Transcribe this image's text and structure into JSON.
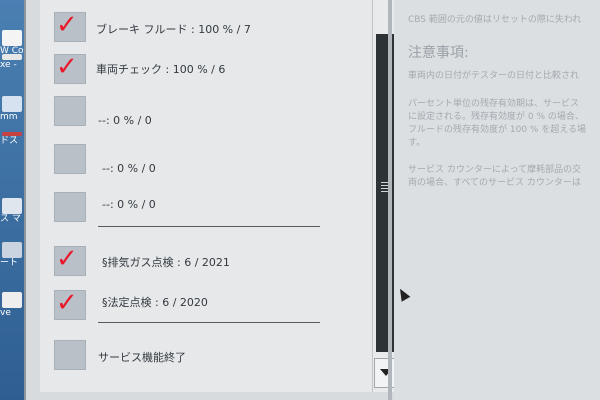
{
  "desktop": {
    "icons": [
      {
        "label": "W Co",
        "color": "#f4f4f4"
      },
      {
        "label": "xe -",
        "color": "#e7e7e7"
      },
      {
        "label": "mm",
        "color": "#d6e2ef"
      },
      {
        "label": "ドス",
        "color": "#c84040"
      },
      {
        "label": "ス マ",
        "color": "#dfe6ee"
      },
      {
        "label": "ート",
        "color": "#c9d4e0"
      },
      {
        "label": "ve",
        "color": "#eeeeee"
      }
    ]
  },
  "list": {
    "items": [
      {
        "label": "ブレーキ フルード : 100 % / 7",
        "checked": true
      },
      {
        "label": "車両チェック : 100 % / 6",
        "checked": true
      },
      {
        "label": "--: 0 % / 0",
        "checked": false
      },
      {
        "label": "--: 0 % / 0",
        "checked": false
      },
      {
        "label": "--: 0 % / 0",
        "checked": false
      },
      {
        "label": "§排気ガス点検 : 6 / 2021",
        "checked": true
      },
      {
        "label": "§法定点検 : 6 / 2020",
        "checked": true
      },
      {
        "label": "サービス機能終了",
        "checked": false
      }
    ],
    "check_glyph": "✓",
    "check_color": "#e8192a"
  },
  "info": {
    "line_top": "CBS 範囲の元の値はリセットの際に失われ",
    "heading": "注意事項:",
    "para1": [
      "車両内の日付がテスターの日付と比較され"
    ],
    "para2": [
      "パーセント単位の残存有効期は、サービス",
      "に設定される。残存有効度が 0 % の場合、",
      "フルードの残存有効度が 100 % を超える場",
      "す。"
    ],
    "para3": [
      "サービス カウンターによって摩耗部品の交",
      "両の場合、すべてのサービス カウンターは"
    ]
  }
}
